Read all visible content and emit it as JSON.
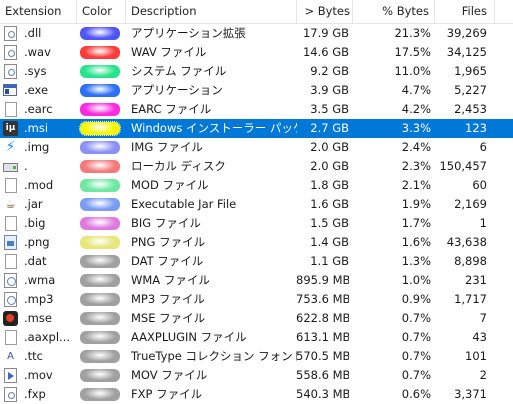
{
  "columns": {
    "extension": "Extension",
    "color": "Color",
    "description": "Description",
    "bytes": "> Bytes",
    "pct_bytes": "% Bytes",
    "files": "Files"
  },
  "rows": [
    {
      "ext": ".dll",
      "desc": "アプリケーション拡張",
      "bytes": "17.9 GB",
      "pct": "21.3%",
      "files": "39,269",
      "color": "#4f55f7",
      "icon": "dll-icon"
    },
    {
      "ext": ".wav",
      "desc": "WAV ファイル",
      "bytes": "14.6 GB",
      "pct": "17.5%",
      "files": "34,125",
      "color": "#ff3b3b",
      "icon": "wav-icon"
    },
    {
      "ext": ".sys",
      "desc": "システム ファイル",
      "bytes": "9.2 GB",
      "pct": "11.0%",
      "files": "1,965",
      "color": "#27e38b",
      "icon": "sys-icon"
    },
    {
      "ext": ".exe",
      "desc": "アプリケーション",
      "bytes": "3.9 GB",
      "pct": "4.7%",
      "files": "5,227",
      "color": "#2b6ff7",
      "icon": "exe-icon"
    },
    {
      "ext": ".earc",
      "desc": "EARC ファイル",
      "bytes": "3.5 GB",
      "pct": "4.2%",
      "files": "2,453",
      "color": "#ff2ae0",
      "icon": "earc-icon"
    },
    {
      "ext": ".msi",
      "desc": "Windows インストーラー パッケー...",
      "bytes": "2.7 GB",
      "pct": "3.3%",
      "files": "123",
      "color": "#f7f700",
      "icon": "msi-icon",
      "selected": true
    },
    {
      "ext": ".img",
      "desc": "IMG ファイル",
      "bytes": "2.0 GB",
      "pct": "2.4%",
      "files": "6",
      "color": "#8a90f5",
      "icon": "img-icon"
    },
    {
      "ext": ".",
      "desc": "ローカル ディスク",
      "bytes": "2.0 GB",
      "pct": "2.3%",
      "files": "150,457",
      "color": "#f27a7a",
      "icon": "drive-icon"
    },
    {
      "ext": ".mod",
      "desc": "MOD ファイル",
      "bytes": "1.8 GB",
      "pct": "2.1%",
      "files": "60",
      "color": "#6fe8a4",
      "icon": "mod-icon"
    },
    {
      "ext": ".jar",
      "desc": "Executable Jar File",
      "bytes": "1.6 GB",
      "pct": "1.9%",
      "files": "2,169",
      "color": "#7a9cf2",
      "icon": "jar-icon"
    },
    {
      "ext": ".big",
      "desc": "BIG ファイル",
      "bytes": "1.5 GB",
      "pct": "1.7%",
      "files": "1",
      "color": "#e07ae0",
      "icon": "big-icon"
    },
    {
      "ext": ".png",
      "desc": "PNG ファイル",
      "bytes": "1.4 GB",
      "pct": "1.6%",
      "files": "43,638",
      "color": "#e6e67a",
      "icon": "png-icon"
    },
    {
      "ext": ".dat",
      "desc": "DAT ファイル",
      "bytes": "1.1 GB",
      "pct": "1.3%",
      "files": "8,898",
      "color": "#a0a0a0",
      "icon": "dat-icon"
    },
    {
      "ext": ".wma",
      "desc": "WMA ファイル",
      "bytes": "895.9 MB",
      "pct": "1.0%",
      "files": "231",
      "color": "#a0a0a0",
      "icon": "wma-icon"
    },
    {
      "ext": ".mp3",
      "desc": "MP3 ファイル",
      "bytes": "753.6 MB",
      "pct": "0.9%",
      "files": "1,717",
      "color": "#a0a0a0",
      "icon": "mp3-icon"
    },
    {
      "ext": ".mse",
      "desc": "MSE ファイル",
      "bytes": "622.8 MB",
      "pct": "0.7%",
      "files": "7",
      "color": "#a0a0a0",
      "icon": "mse-icon"
    },
    {
      "ext": ".aaxpl...",
      "desc": "AAXPLUGIN ファイル",
      "bytes": "613.1 MB",
      "pct": "0.7%",
      "files": "43",
      "color": "#a0a0a0",
      "icon": "aaxplugin-icon"
    },
    {
      "ext": ".ttc",
      "desc": "TrueType コレクション フォント フ...",
      "bytes": "570.5 MB",
      "pct": "0.7%",
      "files": "101",
      "color": "#a0a0a0",
      "icon": "font-icon"
    },
    {
      "ext": ".mov",
      "desc": "MOV ファイル",
      "bytes": "558.6 MB",
      "pct": "0.7%",
      "files": "2",
      "color": "#a0a0a0",
      "icon": "mov-icon"
    },
    {
      "ext": ".fxp",
      "desc": "FXP ファイル",
      "bytes": "540.3 MB",
      "pct": "0.6%",
      "files": "3,371",
      "color": "#a0a0a0",
      "icon": "fxp-icon"
    }
  ]
}
